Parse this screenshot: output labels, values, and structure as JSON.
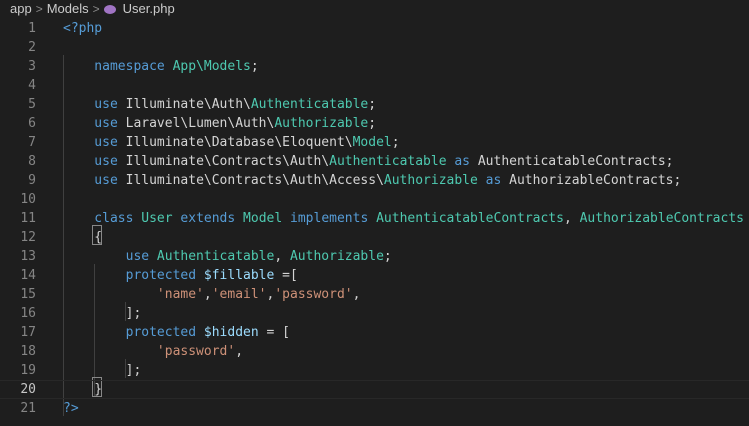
{
  "breadcrumb": {
    "part1": "app",
    "part2": "Models",
    "file": "User.php",
    "file_icon": "php-elephant-icon"
  },
  "colors": {
    "background": "#1e1e1e",
    "keyword": "#569cd6",
    "type": "#4ec9b0",
    "string": "#ce9178",
    "variable": "#9cdcfe",
    "text": "#d4d4d4",
    "line_number": "#858585"
  },
  "editor": {
    "current_line": 20,
    "lines": [
      {
        "n": "1",
        "tokens": [
          {
            "c": "p",
            "t": "<?php"
          }
        ]
      },
      {
        "n": "2",
        "tokens": []
      },
      {
        "n": "3",
        "tokens": [
          {
            "c": "k",
            "t": "    namespace "
          },
          {
            "c": "t",
            "t": "App\\Models"
          },
          {
            "c": "w",
            "t": ";"
          }
        ]
      },
      {
        "n": "4",
        "tokens": []
      },
      {
        "n": "5",
        "tokens": [
          {
            "c": "k",
            "t": "    use "
          },
          {
            "c": "w",
            "t": "Illuminate\\Auth\\"
          },
          {
            "c": "t",
            "t": "Authenticatable"
          },
          {
            "c": "w",
            "t": ";"
          }
        ]
      },
      {
        "n": "6",
        "tokens": [
          {
            "c": "k",
            "t": "    use "
          },
          {
            "c": "w",
            "t": "Laravel\\Lumen\\Auth\\"
          },
          {
            "c": "t",
            "t": "Authorizable"
          },
          {
            "c": "w",
            "t": ";"
          }
        ]
      },
      {
        "n": "7",
        "tokens": [
          {
            "c": "k",
            "t": "    use "
          },
          {
            "c": "w",
            "t": "Illuminate\\Database\\Eloquent\\"
          },
          {
            "c": "t",
            "t": "Model"
          },
          {
            "c": "w",
            "t": ";"
          }
        ]
      },
      {
        "n": "8",
        "tokens": [
          {
            "c": "k",
            "t": "    use "
          },
          {
            "c": "w",
            "t": "Illuminate\\Contracts\\Auth\\"
          },
          {
            "c": "t",
            "t": "Authenticatable"
          },
          {
            "c": "k",
            "t": " as "
          },
          {
            "c": "w",
            "t": "AuthenticatableContracts;"
          }
        ]
      },
      {
        "n": "9",
        "tokens": [
          {
            "c": "k",
            "t": "    use "
          },
          {
            "c": "w",
            "t": "Illuminate\\Contracts\\Auth\\Access\\"
          },
          {
            "c": "t",
            "t": "Authorizable"
          },
          {
            "c": "k",
            "t": " as "
          },
          {
            "c": "w",
            "t": "AuthorizableContracts;"
          }
        ]
      },
      {
        "n": "10",
        "tokens": []
      },
      {
        "n": "11",
        "tokens": [
          {
            "c": "k",
            "t": "    class "
          },
          {
            "c": "t",
            "t": "User"
          },
          {
            "c": "k",
            "t": " extends "
          },
          {
            "c": "t",
            "t": "Model"
          },
          {
            "c": "k",
            "t": " implements "
          },
          {
            "c": "t",
            "t": "AuthenticatableContracts"
          },
          {
            "c": "w",
            "t": ", "
          },
          {
            "c": "t",
            "t": "AuthorizableContracts"
          }
        ]
      },
      {
        "n": "12",
        "tokens": [
          {
            "c": "w",
            "t": "    {"
          }
        ]
      },
      {
        "n": "13",
        "tokens": [
          {
            "c": "k",
            "t": "        use "
          },
          {
            "c": "t",
            "t": "Authenticatable"
          },
          {
            "c": "w",
            "t": ", "
          },
          {
            "c": "t",
            "t": "Authorizable"
          },
          {
            "c": "w",
            "t": ";"
          }
        ]
      },
      {
        "n": "14",
        "tokens": [
          {
            "c": "k",
            "t": "        protected "
          },
          {
            "c": "v",
            "t": "$fillable"
          },
          {
            "c": "w",
            "t": " =["
          }
        ]
      },
      {
        "n": "15",
        "tokens": [
          {
            "c": "s",
            "t": "            'name'"
          },
          {
            "c": "w",
            "t": ","
          },
          {
            "c": "s",
            "t": "'email'"
          },
          {
            "c": "w",
            "t": ","
          },
          {
            "c": "s",
            "t": "'password'"
          },
          {
            "c": "w",
            "t": ","
          }
        ]
      },
      {
        "n": "16",
        "tokens": [
          {
            "c": "w",
            "t": "        ];"
          }
        ]
      },
      {
        "n": "17",
        "tokens": [
          {
            "c": "k",
            "t": "        protected "
          },
          {
            "c": "v",
            "t": "$hidden"
          },
          {
            "c": "w",
            "t": " = ["
          }
        ]
      },
      {
        "n": "18",
        "tokens": [
          {
            "c": "s",
            "t": "            'password'"
          },
          {
            "c": "w",
            "t": ","
          }
        ]
      },
      {
        "n": "19",
        "tokens": [
          {
            "c": "w",
            "t": "        ];"
          }
        ]
      },
      {
        "n": "20",
        "tokens": [
          {
            "c": "w",
            "t": "    }"
          }
        ]
      },
      {
        "n": "21",
        "tokens": [
          {
            "c": "p",
            "t": "?>"
          }
        ]
      }
    ]
  }
}
